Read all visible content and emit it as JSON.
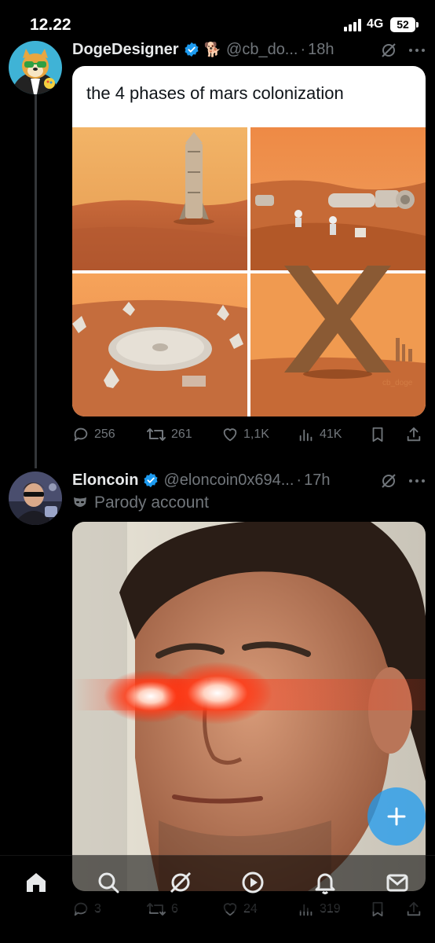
{
  "status_bar": {
    "time": "12.22",
    "network": "4G",
    "battery": "52"
  },
  "tweets": [
    {
      "display_name": "DogeDesigner",
      "handle": "@cb_do...",
      "separator": "·",
      "time": "18h",
      "badge_emoji": "🐕",
      "media_text": "the 4 phases of mars colonization",
      "media_overlay_text": "cb_doge",
      "stats": {
        "replies": "256",
        "reposts": "261",
        "likes": "1,1K",
        "views": "41K"
      }
    },
    {
      "display_name": "Eloncoin",
      "handle": "@eloncoin0x694...",
      "separator": "·",
      "time": "17h",
      "label": "Parody account",
      "stats": {
        "replies": "3",
        "reposts": "6",
        "likes": "24",
        "views": "319"
      }
    }
  ],
  "icons": {
    "verified": "verified-badge-icon",
    "grok": "grok-icon",
    "more": "more-icon",
    "reply": "reply-icon",
    "repost": "repost-icon",
    "like": "like-icon",
    "views": "views-icon",
    "bookmark": "bookmark-icon",
    "share": "share-icon",
    "compose": "compose-plus-icon"
  },
  "bottom_nav": [
    "home",
    "search",
    "grok",
    "spaces",
    "notifications",
    "messages"
  ],
  "colors": {
    "background": "#000000",
    "accent": "#1d9bf0",
    "muted": "#71767b",
    "text": "#e7e9ea"
  }
}
